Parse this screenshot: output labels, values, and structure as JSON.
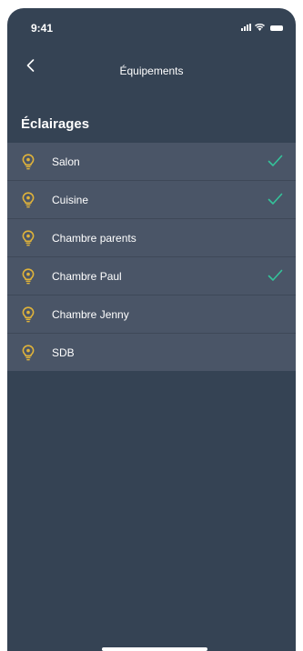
{
  "status_bar": {
    "time": "9:41"
  },
  "nav": {
    "title": "Équipements",
    "back_icon": "chevron-left-icon"
  },
  "section": {
    "title": "Éclairages"
  },
  "colors": {
    "background": "#354354",
    "list_background": "#4a5567",
    "bulb": "#e0b33a",
    "check": "#34c39a"
  },
  "items": [
    {
      "label": "Salon",
      "icon": "bulb-icon",
      "checked": true
    },
    {
      "label": "Cuisine",
      "icon": "bulb-icon",
      "checked": true
    },
    {
      "label": "Chambre parents",
      "icon": "bulb-icon",
      "checked": false
    },
    {
      "label": "Chambre Paul",
      "icon": "bulb-icon",
      "checked": true
    },
    {
      "label": "Chambre Jenny",
      "icon": "bulb-icon",
      "checked": false
    },
    {
      "label": "SDB",
      "icon": "bulb-icon",
      "checked": false
    }
  ]
}
